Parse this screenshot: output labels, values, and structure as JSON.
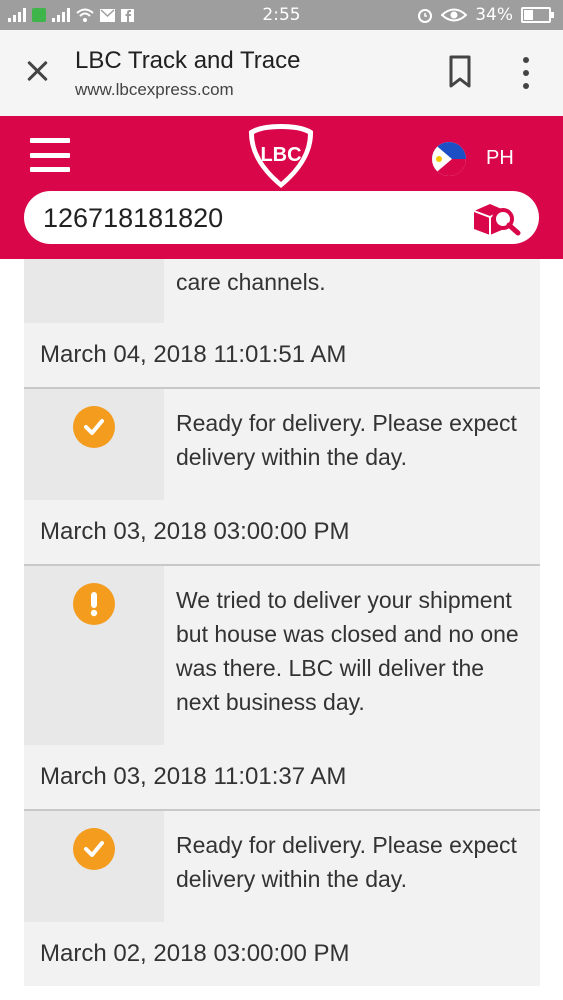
{
  "status_bar": {
    "time": "2:55",
    "battery": "34%",
    "battery_level": 0.34
  },
  "browser": {
    "title": "LBC Track and Trace",
    "url": "www.lbcexpress.com"
  },
  "header": {
    "logo_text": "LBC",
    "country": "PH",
    "search_value": "126718181820"
  },
  "timeline": {
    "partial_text": "care channels.",
    "entries": [
      {
        "date": "March 04, 2018 11:01:51 AM",
        "status": "check",
        "message": "Ready for delivery. Please expect delivery within the day."
      },
      {
        "date": "March 03, 2018 03:00:00 PM",
        "status": "warning",
        "message": "We tried to deliver your shipment but house was closed and no one was there. LBC will deliver the next business day."
      },
      {
        "date": "March 03, 2018 11:01:37 AM",
        "status": "check",
        "message": "Ready for delivery. Please expect delivery within the day."
      },
      {
        "date": "March 02, 2018 03:00:00 PM"
      }
    ]
  },
  "colors": {
    "brand": "#d9064a",
    "status_orange": "#f39c1e"
  }
}
